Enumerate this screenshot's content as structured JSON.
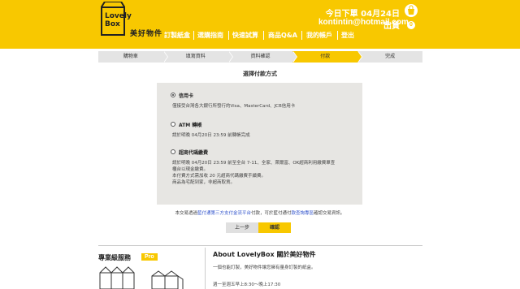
{
  "header": {
    "logo_line1": "Lovely",
    "logo_line2": "Box",
    "brand_name": "美好物件",
    "ship_note": "今日下單 04月24日 出貨",
    "email": "kontintin@hotmail.com",
    "cart_count": "0",
    "nav": [
      "訂製紙盒",
      "選購指南",
      "快速試算",
      "商品Q&A",
      "我的帳戶",
      "登出"
    ],
    "accent_color": "#f8c800"
  },
  "steps": {
    "items": [
      "購物車",
      "填寫資料",
      "資料確認",
      "付款",
      "完成"
    ],
    "active_index": 3
  },
  "payment": {
    "title": "選擇付款方式",
    "options": [
      {
        "label": "信用卡",
        "checked": true,
        "desc": [
          "僅接受台灣各大銀行所發行的Visa、MasterCard、JCB信用卡"
        ]
      },
      {
        "label": "ATM 轉帳",
        "checked": false,
        "desc": [
          "請於明晚 04月20日 23:59 前轉帳完成"
        ]
      },
      {
        "label": "超商代碼繳費",
        "checked": false,
        "desc": [
          "請於明晚 04月20日 23:59 前至全台 7-11、全家、萊爾富、OK超商利用繳費單查",
          "櫃台以現金繳費。",
          "本付費方式需加收 20 元超商代碼繳費手續費。",
          "商品為宅配到家，非超商取貨。"
        ]
      }
    ],
    "notice_pre": "本交易透過",
    "notice_link1": "藍付通第三方支付金流平台",
    "notice_mid": "付款，可於藍付通付",
    "notice_link2": "款查詢專區",
    "notice_post": "確認交易資訊。",
    "prev_label": "上一步",
    "next_label": "確認"
  },
  "footer": {
    "pro_title": "專業級服務",
    "pro_badge": "Pro",
    "about_title": "About LovelyBox 關於美好物件",
    "about_text": "一個也能訂製，美好物件讓您擁有量身訂製的紙盒。",
    "about_hours": "週一至週五早上8:30～晚上17:30"
  }
}
